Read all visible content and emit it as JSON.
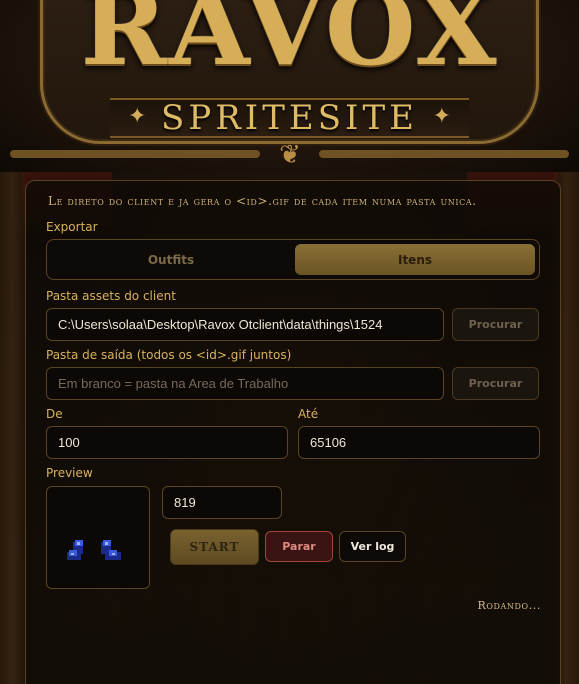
{
  "header": {
    "logo": "RAVOX",
    "subtitle": "SPRITESITE"
  },
  "description": "Le direto do client e ja gera o <id>.gif de cada item numa pasta unica.",
  "export": {
    "label": "Exportar",
    "options": [
      "Outfits",
      "Itens"
    ],
    "selected": "Itens"
  },
  "assets": {
    "label": "Pasta assets do client",
    "value": "C:\\Users\\solaa\\Desktop\\Ravox Otclient\\data\\things\\1524",
    "browse_label": "Procurar"
  },
  "output": {
    "label": "Pasta de saída (todos os <id>.gif juntos)",
    "value": "",
    "placeholder": "Em branco = pasta na Area de Trabalho",
    "browse_label": "Procurar"
  },
  "range": {
    "from_label": "De",
    "from_value": "100",
    "to_label": "Até",
    "to_value": "65106"
  },
  "preview": {
    "label": "Preview",
    "current_id": "819",
    "sprite_icon": "blue-boots-icon"
  },
  "actions": {
    "start_label": "START",
    "stop_label": "Parar",
    "log_label": "Ver log"
  },
  "status": "Rodando...",
  "colors": {
    "accent": "#d9b25c",
    "selected_segment": "#7a6230",
    "stop": "#a0443c"
  }
}
